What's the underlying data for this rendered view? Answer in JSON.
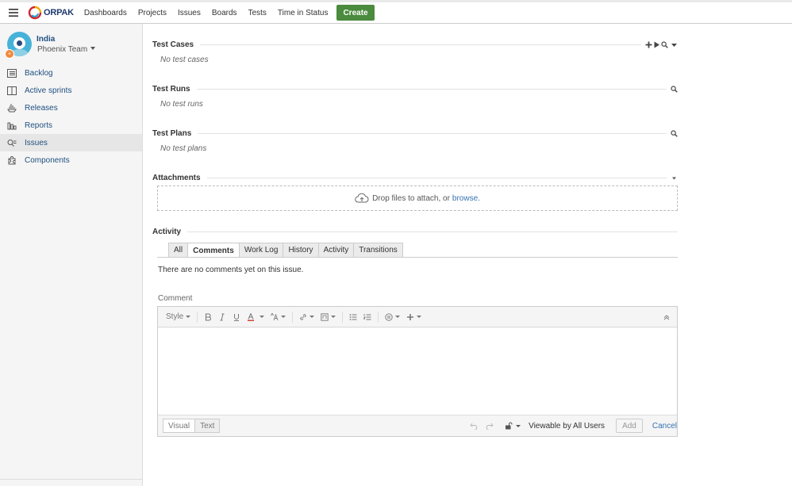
{
  "nav": {
    "logo_text": "ORPAK",
    "items": [
      "Dashboards",
      "Projects",
      "Issues",
      "Boards",
      "Tests",
      "Time in Status"
    ],
    "create_label": "Create",
    "create_color": "#4a8b3d"
  },
  "sidebar": {
    "project_name": "India",
    "team_name": "Phoenix Team",
    "badge": "+",
    "items": [
      {
        "label": "Backlog",
        "icon": "backlog-icon"
      },
      {
        "label": "Active sprints",
        "icon": "board-icon"
      },
      {
        "label": "Releases",
        "icon": "ship-icon"
      },
      {
        "label": "Reports",
        "icon": "reports-icon"
      },
      {
        "label": "Issues",
        "icon": "issues-icon",
        "active": true
      },
      {
        "label": "Components",
        "icon": "puzzle-icon"
      }
    ]
  },
  "sections": {
    "test_cases": {
      "title": "Test Cases",
      "empty": "No test cases"
    },
    "test_runs": {
      "title": "Test Runs",
      "empty": "No test runs"
    },
    "test_plans": {
      "title": "Test Plans",
      "empty": "No test plans"
    },
    "attachments": {
      "title": "Attachments",
      "drop_text": "Drop files to attach, or",
      "browse_link": "browse."
    },
    "activity": {
      "title": "Activity",
      "tabs": [
        "All",
        "Comments",
        "Work Log",
        "History",
        "Activity",
        "Transitions"
      ],
      "active_tab": "Comments",
      "no_comments": "There are no comments yet on this issue."
    }
  },
  "comment": {
    "label": "Comment",
    "toolbar": {
      "style_label": "Style"
    },
    "modes": [
      "Visual",
      "Text"
    ],
    "active_mode": "Visual",
    "viewable": "Viewable by All Users",
    "add_label": "Add",
    "cancel_label": "Cancel"
  },
  "colors": {
    "link": "#3572b0",
    "sidebar_link": "#205081"
  }
}
